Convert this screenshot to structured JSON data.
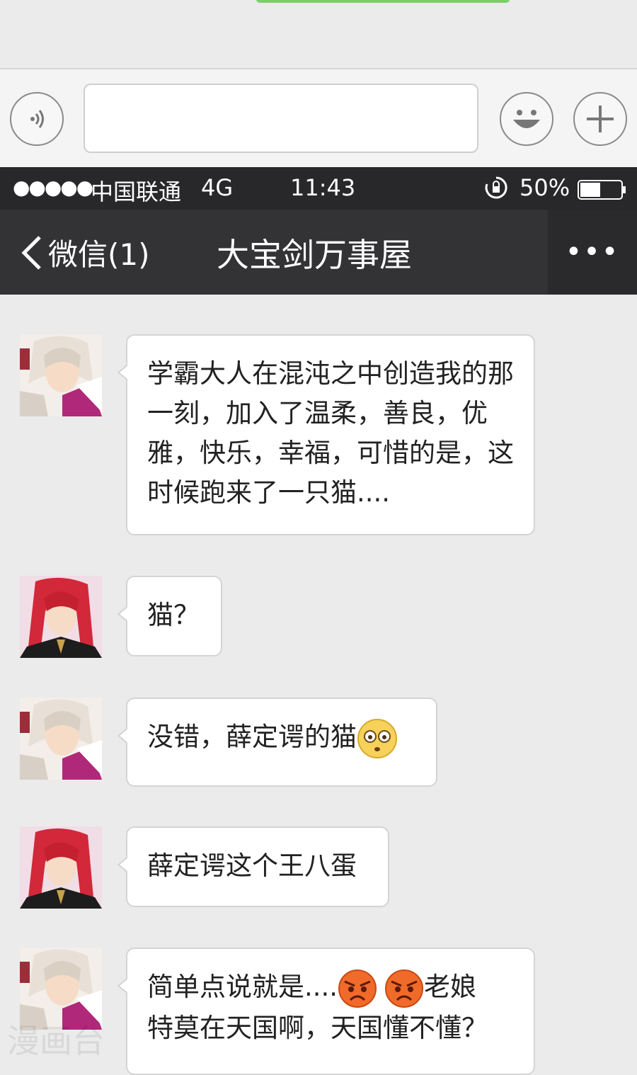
{
  "status_bar": {
    "signal": "●●●●●",
    "carrier": "中国联通",
    "network": "4G",
    "time": "11:43",
    "battery": "50%"
  },
  "nav": {
    "back_label": "微信(1)",
    "title": "大宝剑万事屋",
    "more": "•••"
  },
  "messages": [
    {
      "sender": "white-hair",
      "text": "学霸大人在混沌之中创造我的那一刻，加入了温柔，善良，优雅，快乐，幸福，可惜的是，这时候跑来了一只猫...."
    },
    {
      "sender": "red-hair",
      "text": "猫？"
    },
    {
      "sender": "white-hair",
      "text": "没错，薛定谔的猫",
      "emoji": "flushed-face-emoji"
    },
    {
      "sender": "red-hair",
      "text": "薛定谔这个王八蛋"
    },
    {
      "sender": "white-hair",
      "text_a": "简单点说就是....",
      "text_b": "老娘",
      "text_c": "特莫在天国啊，天国懂不懂？",
      "emoji": "angry-face-emoji"
    }
  ],
  "watermark": "漫画台"
}
